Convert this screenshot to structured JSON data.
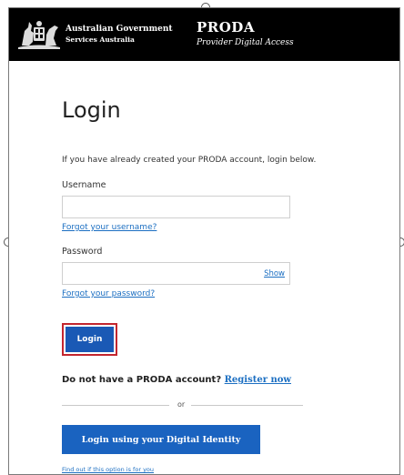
{
  "header": {
    "gov_line1": "Australian Government",
    "gov_line2": "Services Australia",
    "app_title": "PRODA",
    "app_subtitle": "Provider Digital Access"
  },
  "login": {
    "title": "Login",
    "intro": "If you have already created your PRODA account, login below.",
    "username_label": "Username",
    "username_value": "",
    "forgot_username": "Forgot your username?",
    "password_label": "Password",
    "password_value": "",
    "show_label": "Show",
    "forgot_password": "Forgot your password?",
    "login_button": "Login",
    "no_account_text": "Do not have a PRODA account?",
    "register_link": "Register now",
    "or_text": "or",
    "digital_identity_button": "Login using your Digital Identity",
    "find_out_link": "Find out if this option is for you"
  },
  "colors": {
    "header_bg": "#000000",
    "primary_button": "#1a59b5",
    "link": "#1c6fc2",
    "focus_outline": "#c3262e"
  },
  "icons": {
    "crest": "coat-of-arms-icon"
  }
}
